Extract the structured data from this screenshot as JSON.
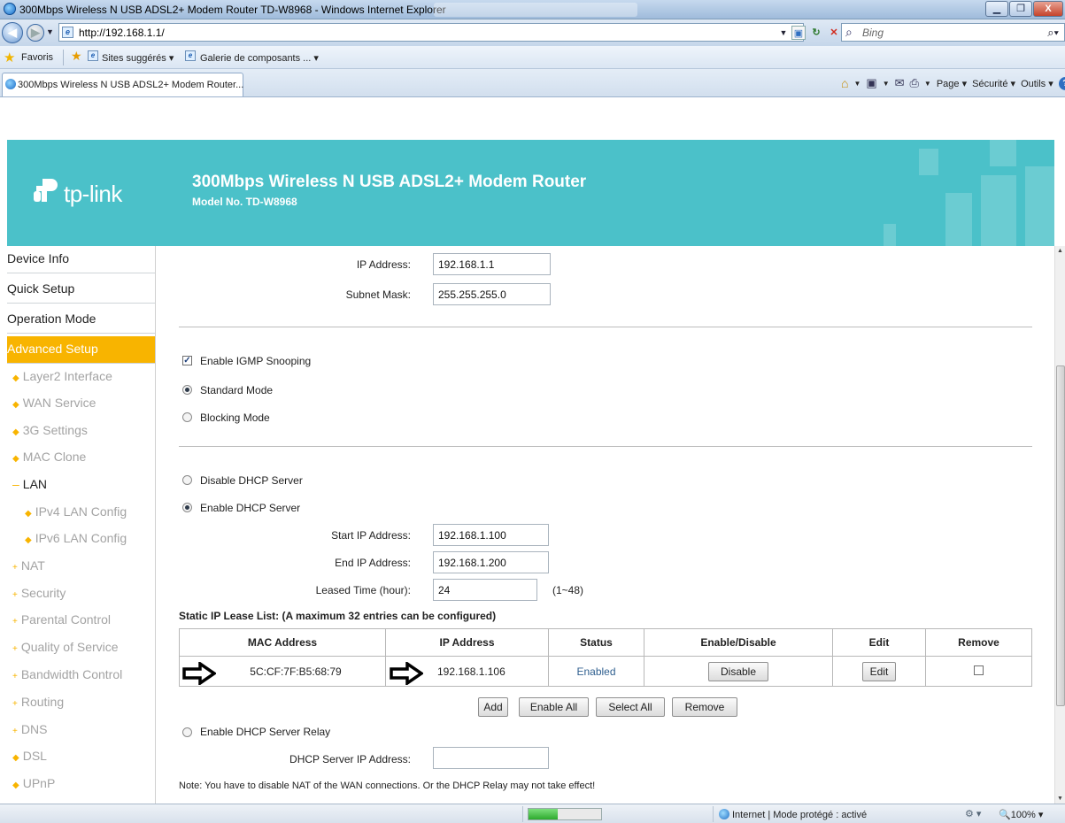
{
  "browser": {
    "window_title": "300Mbps Wireless N USB ADSL2+ Modem Router TD-W8968 - Windows Internet Explorer",
    "url": "http://192.168.1.1/",
    "search_placeholder": "Bing",
    "favorites_label": "Favoris",
    "fav_items": [
      "Sites suggérés ▾",
      "Galerie de composants ... ▾"
    ],
    "tab_label": "300Mbps Wireless N USB ADSL2+ Modem Router...",
    "tools": {
      "page": "Page ▾",
      "security": "Sécurité ▾",
      "tools": "Outils ▾"
    },
    "status_zone": "Internet | Mode protégé : activé",
    "zoom": "100%",
    "load_progress": 0.4
  },
  "router": {
    "brand": "tp-link",
    "product_title": "300Mbps Wireless N USB ADSL2+ Modem Router",
    "model": "Model No. TD-W8968",
    "brand_color": "#4bc1c9",
    "accent_color": "#f8b400"
  },
  "sidebar": {
    "main_items": [
      "Device Info",
      "Quick Setup",
      "Operation Mode",
      "Advanced Setup"
    ],
    "active_item": "Advanced Setup",
    "sub_items": [
      "Layer2 Interface",
      "WAN Service",
      "3G Settings",
      "MAC Clone",
      "LAN",
      "IPv4 LAN Config",
      "IPv6 LAN Config",
      "NAT",
      "Security",
      "Parental Control",
      "Quality of Service",
      "Bandwidth Control",
      "Routing",
      "DNS",
      "DSL",
      "UPnP"
    ]
  },
  "lan": {
    "ip_label": "IP Address:",
    "ip_value": "192.168.1.1",
    "mask_label": "Subnet Mask:",
    "mask_value": "255.255.255.0",
    "igmp_label": "Enable IGMP Snooping",
    "igmp_checked": true,
    "standard_mode": "Standard Mode",
    "blocking_mode": "Blocking Mode",
    "disable_dhcp": "Disable DHCP Server",
    "enable_dhcp": "Enable DHCP Server",
    "start_label": "Start IP Address:",
    "start_value": "192.168.1.100",
    "end_label": "End IP Address:",
    "end_value": "192.168.1.200",
    "lease_label": "Leased Time (hour):",
    "lease_value": "24",
    "lease_range": "(1~48)",
    "static_title": "Static IP Lease List: (A maximum 32 entries can be configured)",
    "table_headers": [
      "MAC Address",
      "IP Address",
      "Status",
      "Enable/Disable",
      "Edit",
      "Remove"
    ],
    "row": {
      "mac": "5C:CF:7F:B5:68:79",
      "ip": "192.168.1.106",
      "status": "Enabled",
      "toggle_button": "Disable",
      "edit_button": "Edit"
    },
    "buttons": [
      "Add",
      "Enable All",
      "Select All",
      "Remove"
    ],
    "relay_label": "Enable DHCP Server Relay",
    "relay_ip_label": "DHCP Server IP Address:",
    "note": "Note: You have to disable NAT of the WAN connections. Or the DHCP Relay may not take effect!"
  }
}
